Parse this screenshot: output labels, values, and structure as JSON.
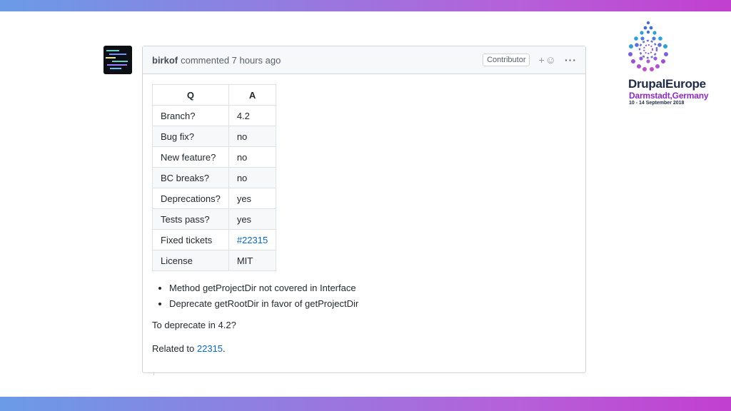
{
  "comment": {
    "author": "birkof",
    "meta": "commented 7 hours ago",
    "badge": "Contributor",
    "react_plus": "+",
    "react_face": "☺",
    "more": "···",
    "table": {
      "headers": [
        "Q",
        "A"
      ],
      "rows": [
        {
          "q": "Branch?",
          "a": "4.2"
        },
        {
          "q": "Bug fix?",
          "a": "no"
        },
        {
          "q": "New feature?",
          "a": "no"
        },
        {
          "q": "BC breaks?",
          "a": "no"
        },
        {
          "q": "Deprecations?",
          "a": "yes"
        },
        {
          "q": "Tests pass?",
          "a": "yes"
        },
        {
          "q": "Fixed tickets",
          "a": "#22315"
        },
        {
          "q": "License",
          "a": "MIT"
        }
      ]
    },
    "bullets": [
      "Method getProjectDir not covered in Interface",
      "Deprecate getRootDir in favor of getProjectDir"
    ],
    "question": "To deprecate in 4.2?",
    "related_prefix": "Related to",
    "related_link": "22315",
    "related_suffix": "."
  },
  "logo": {
    "title": "DrupalEurope",
    "subtitle": "Darmstadt,Germany",
    "dates": "10 - 14 September 2018"
  },
  "colors": {
    "band_start": "#6b9be6",
    "band_end": "#c23fd0",
    "link": "#0366d6"
  },
  "icons": [
    "avatar-image",
    "add-reaction-icon",
    "more-options-icon",
    "drupal-europe-logo"
  ]
}
